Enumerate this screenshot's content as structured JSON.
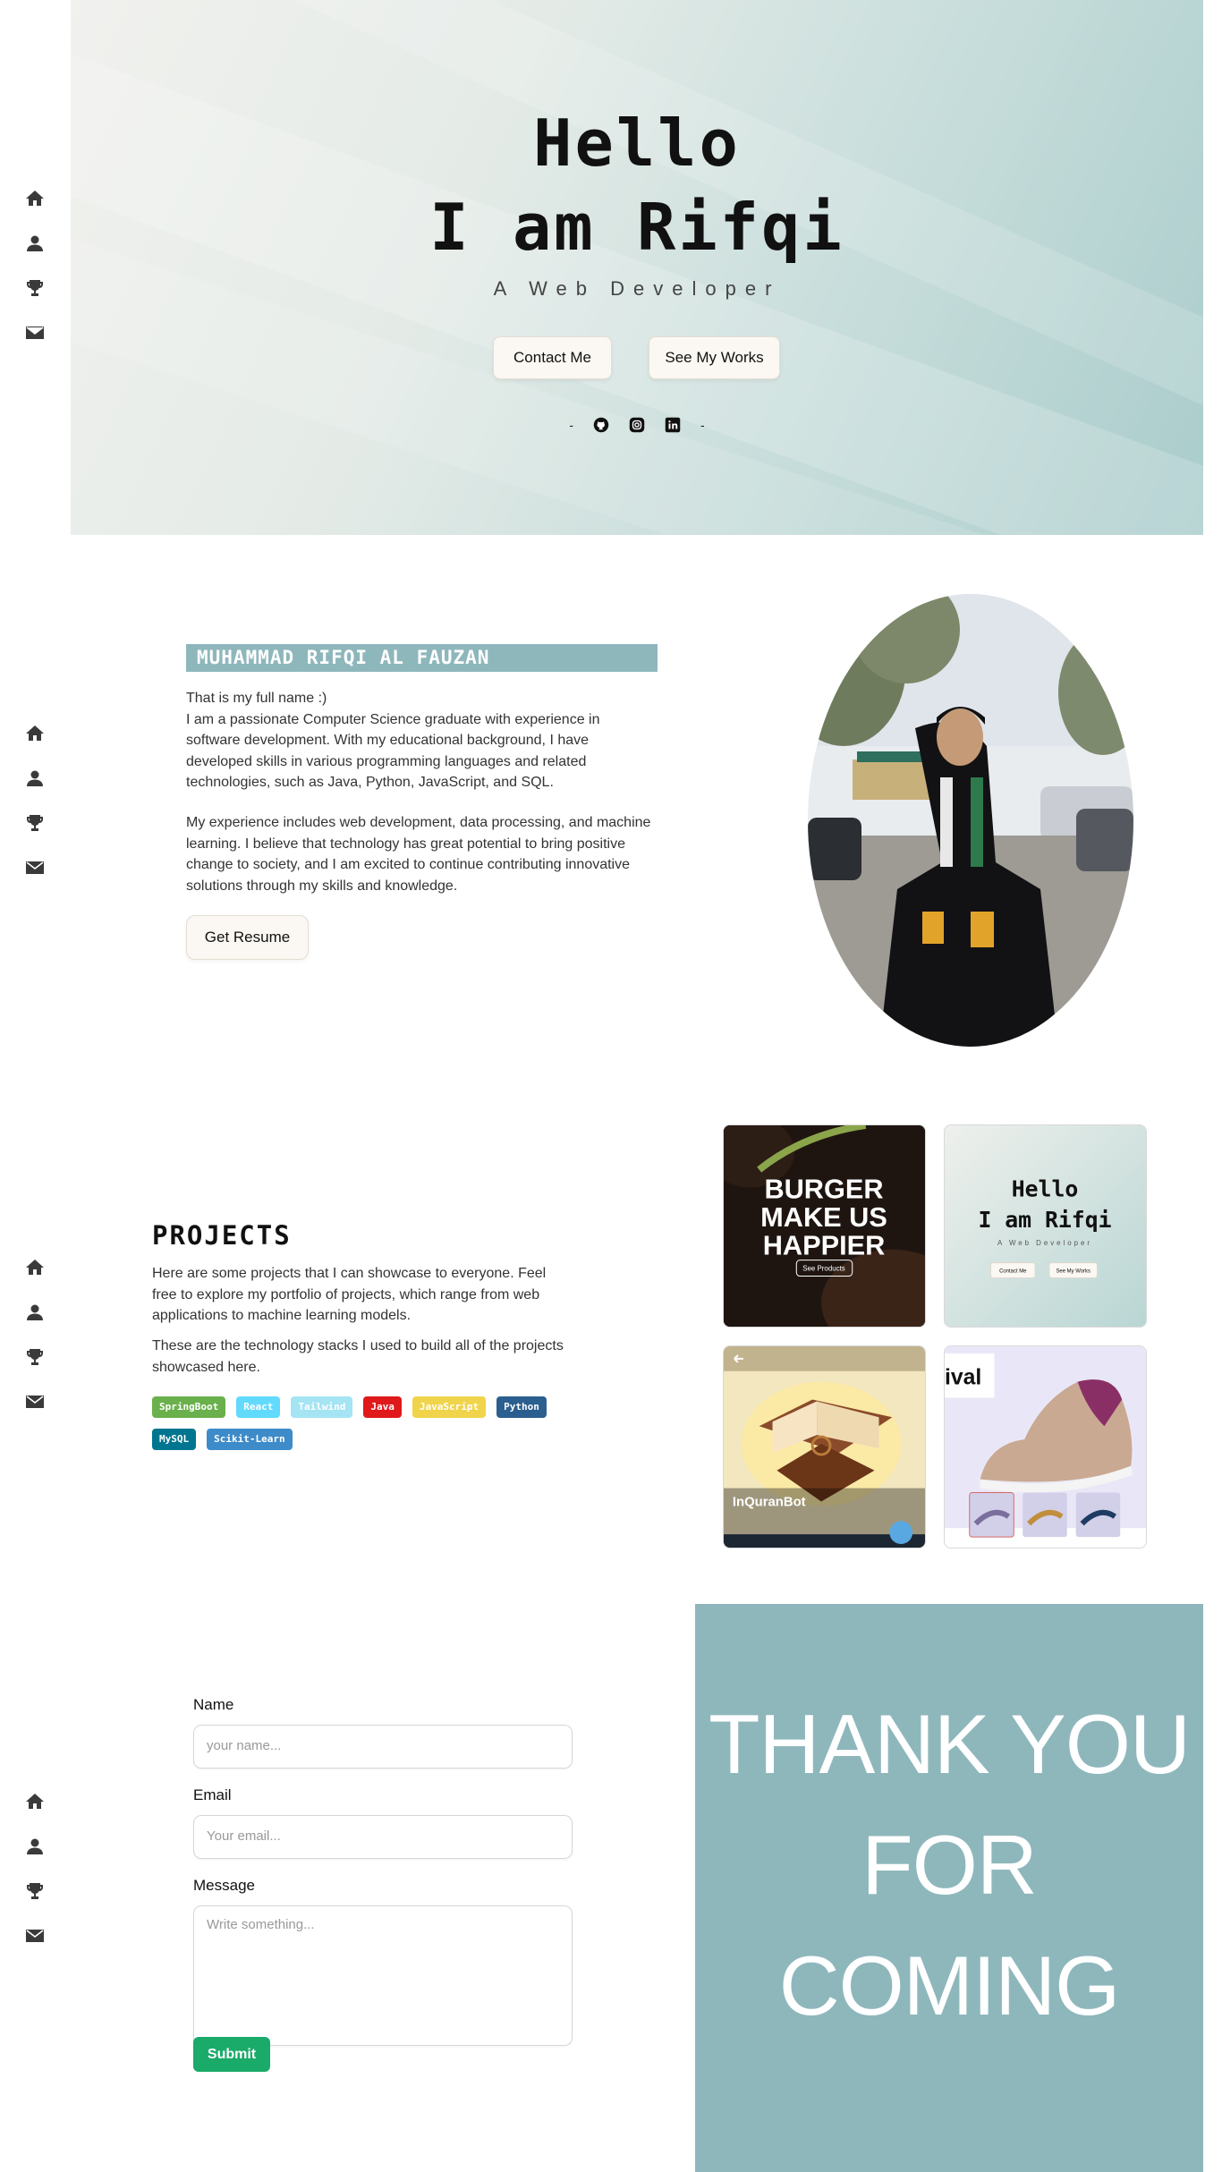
{
  "nav": {
    "items": [
      "home-icon",
      "user-icon",
      "trophy-icon",
      "mail-icon"
    ]
  },
  "hero": {
    "line1": "Hello",
    "line2": "I am Rifqi",
    "subtitle": "A Web Developer",
    "contact_label": "Contact Me",
    "works_label": "See My Works",
    "dash": "-",
    "social": [
      "github-icon",
      "instagram-icon",
      "linkedin-icon"
    ]
  },
  "about": {
    "name": "MUHAMMAD RIFQI AL FAUZAN",
    "intro": "That is my full name :)",
    "p1": "I am a passionate Computer Science graduate with experience in software development. With my educational background, I have developed skills in various programming languages and related technologies, such as Java, Python, JavaScript, and SQL.",
    "p2": "My experience includes web development, data processing, and machine learning. I believe that technology has great potential to bring positive change to society, and I am excited to continue contributing innovative solutions through my skills and knowledge.",
    "resume_label": "Get Resume"
  },
  "projects": {
    "title": "PROJECTS",
    "p1": "Here are some projects that I can showcase to everyone. Feel free to explore my portfolio of projects, which range from web applications to machine learning models.",
    "p2": "These are the technology stacks I used to build all of the projects showcased here.",
    "tags": [
      {
        "label": "SpringBoot",
        "color": "#6ab04c"
      },
      {
        "label": "React",
        "color": "#61dafb"
      },
      {
        "label": "Tailwind",
        "color": "#a5e4f3"
      },
      {
        "label": "Java",
        "color": "#e0191b"
      },
      {
        "label": "JavaScript",
        "color": "#f0d44b"
      },
      {
        "label": "Python",
        "color": "#2b5f8f"
      },
      {
        "label": "MySQL",
        "color": "#00758f"
      },
      {
        "label": "Scikit-Learn",
        "color": "#3d8bc9"
      }
    ],
    "tiles": {
      "burger": {
        "line1": "BURGER",
        "line2": "MAKE US",
        "line3": "HAPPIER",
        "button": "See Products"
      },
      "portfolio": {
        "line1": "Hello",
        "line2": "I am Rifqi",
        "sub": "A Web Developer",
        "b1": "Contact Me",
        "b2": "See My Works"
      },
      "quran": {
        "title": "InQuranBot"
      },
      "shoe": {
        "partial": "ival"
      }
    }
  },
  "contact": {
    "name_label": "Name",
    "name_placeholder": "your name...",
    "email_label": "Email",
    "email_placeholder": "Your email...",
    "message_label": "Message",
    "message_placeholder": "Write something...",
    "submit_label": "Submit"
  },
  "thanks": {
    "line1": "THANK YOU",
    "line2": "FOR",
    "line3": "COMING"
  },
  "colors": {
    "accent": "#8eb7bc",
    "submit": "#1aaa6a"
  }
}
